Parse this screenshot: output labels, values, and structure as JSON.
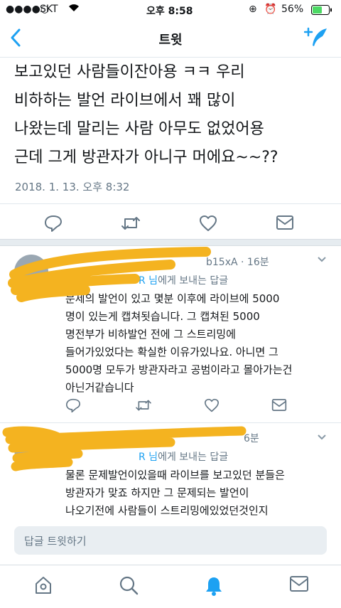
{
  "status_bar": {
    "carrier": "SKT",
    "time": "오후 8:58",
    "battery": "56%"
  },
  "nav": {
    "title": "트윗"
  },
  "tweet": {
    "lines": [
      "보고있던 사람들이잔아용 ㅋㅋ 우리",
      "비하하는 발언 라이브에서 꽤 많이",
      "나왔는데 말리는 사람 아무도 없었어용",
      "근데 그게 방관자가 아니구 머에요~~??"
    ],
    "timestamp": "2018. 1. 13. 오후 8:32"
  },
  "replies": [
    {
      "meta": "b15xA · 16분",
      "reply_to_user": "R 님",
      "reply_to_suffix": "에게 보내는 답글",
      "lines": [
        "문제의 발언이 있고 몇분 이후에 라이브에 5000",
        "명이 있는게 캡쳐됫습니다. 그 캡쳐된 5000",
        "명전부가 비하발언 전에 그 스트리밍에",
        "들어가있었다는 확실한 이유가있나요. 아니면 그",
        "5000명 모두가 방관자라고 공범이라고 몰아가는건",
        "아닌거같습니다"
      ]
    },
    {
      "meta": "6분",
      "reply_to_user": "R 님",
      "reply_to_suffix": "에게 보내는 답글",
      "lines": [
        "물론 문제발언이있을때 라이브를 보고있던 분들은",
        "방관자가 맞죠 하지만 그 문제되는 발언이",
        "나오기전에 사람들이 스트리밍에있었던것인지"
      ]
    }
  ],
  "compose": {
    "placeholder": "답글 트윗하기"
  },
  "colors": {
    "accent": "#1da1f2",
    "icon": "#657786",
    "highlight": "#f4b320"
  }
}
